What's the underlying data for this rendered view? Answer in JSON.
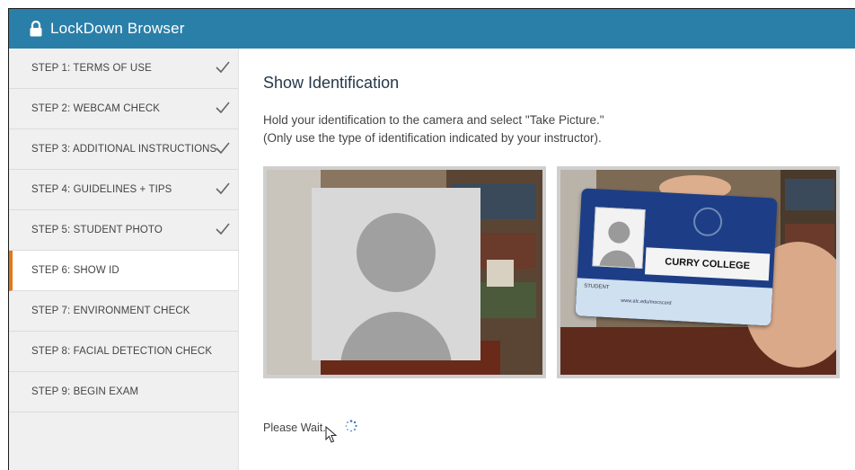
{
  "window": {
    "title": "LockDown Browser"
  },
  "steps": [
    {
      "label": "STEP 1: TERMS OF USE",
      "done": true
    },
    {
      "label": "STEP 2: WEBCAM CHECK",
      "done": true
    },
    {
      "label": "STEP 3: ADDITIONAL INSTRUCTIONS",
      "done": true
    },
    {
      "label": "STEP 4: GUIDELINES + TIPS",
      "done": true
    },
    {
      "label": "STEP 5: STUDENT PHOTO",
      "done": true
    },
    {
      "label": "STEP 6: SHOW ID",
      "done": false,
      "active": true
    },
    {
      "label": "STEP 7: ENVIRONMENT CHECK",
      "done": false
    },
    {
      "label": "STEP 8: FACIAL DETECTION CHECK",
      "done": false
    },
    {
      "label": "STEP 9: BEGIN EXAM",
      "done": false
    }
  ],
  "main": {
    "heading": "Show Identification",
    "instruction_line1": "Hold your identification to the camera and select \"Take Picture.\"",
    "instruction_line2": "(Only use the type of identification indicated by your instructor).",
    "id_card": {
      "name": "CURRY COLLEGE",
      "label": "STUDENT",
      "url": "www.alc.edu/mocscard"
    },
    "status": "Please Wait..."
  },
  "colors": {
    "titlebar": "#2a7fa8",
    "active_step_marker": "#e07a1a",
    "sidebar_bg": "#f0f0f0"
  },
  "icons": {
    "titlebar": "lock-icon",
    "step_done": "checkmark-icon",
    "status": "spinner-icon",
    "pointer": "mouse-cursor-icon"
  }
}
